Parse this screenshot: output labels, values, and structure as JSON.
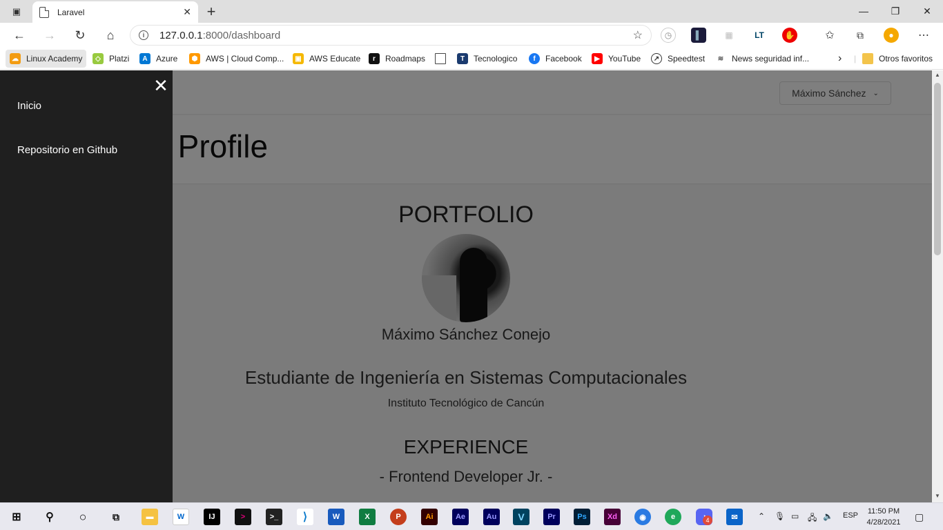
{
  "browser": {
    "tab_title": "Laravel",
    "url_host": "127.0.0.1",
    "url_rest": ":8000/dashboard"
  },
  "bookmarks": [
    {
      "label": "Linux Academy",
      "color": "#f39c12"
    },
    {
      "label": "Platzi",
      "color": "#98ca3f"
    },
    {
      "label": "Azure",
      "color": "#0078d4"
    },
    {
      "label": "AWS | Cloud Comp...",
      "color": "#ff9900"
    },
    {
      "label": "AWS Educate",
      "color": "#f5b800"
    },
    {
      "label": "Roadmaps",
      "color": "#111111"
    },
    {
      "label": "",
      "color": "#ffffff"
    },
    {
      "label": "Tecnologico",
      "color": "#1b3b6f"
    },
    {
      "label": "Facebook",
      "color": "#1877f2"
    },
    {
      "label": "YouTube",
      "color": "#ff0000"
    },
    {
      "label": "Speedtest",
      "color": "#333333"
    },
    {
      "label": "News seguridad inf...",
      "color": "#555555"
    }
  ],
  "bookmarks_other": "Otros favoritos",
  "page": {
    "user_menu": "Máximo Sánchez",
    "profile_title": "ximo's Profile",
    "portfolio_heading": "PORTFOLIO",
    "name": "Máximo Sánchez Conejo",
    "role": "Estudiante de Ingeniería en Sistemas Computacionales",
    "school": "Instituto Tecnológico de Cancún",
    "experience_heading": "EXPERIENCE",
    "experience_item": "- Frontend Developer Jr. -"
  },
  "drawer": {
    "items": [
      "Inicio",
      "Repositorio en Github"
    ]
  },
  "taskbar": {
    "time": "11:50 PM",
    "date": "4/28/2021",
    "lang": "ESP",
    "discord_badge": "4"
  }
}
